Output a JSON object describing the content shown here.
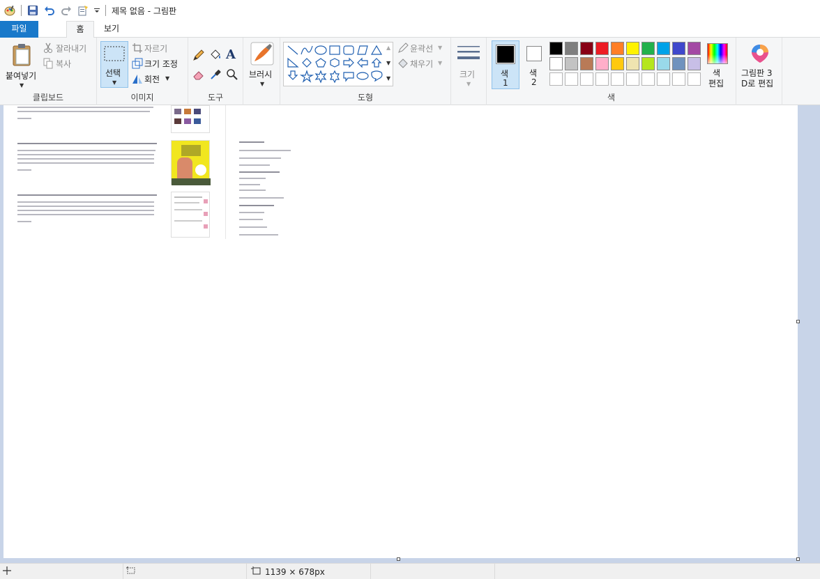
{
  "titlebar": {
    "title": "제목 없음 - 그림판",
    "icons": [
      "paint-app-icon",
      "save-icon",
      "undo-icon",
      "redo-icon",
      "properties-icon",
      "customize-dropdown-icon"
    ]
  },
  "tabs": [
    {
      "label": "파일"
    },
    {
      "label": "홈"
    },
    {
      "label": "보기"
    }
  ],
  "ribbon": {
    "clipboard": {
      "paste": "붙여넣기",
      "cut": "잘라내기",
      "copy": "복사",
      "group": "클립보드"
    },
    "image": {
      "select": "선택",
      "crop": "자르기",
      "resize": "크기 조정",
      "rotate": "회전",
      "group": "이미지"
    },
    "tools": {
      "brush": "브러시",
      "group": "도구"
    },
    "shapes": {
      "outline": "윤곽선",
      "fill": "채우기",
      "group": "도형"
    },
    "size": {
      "label": "크기"
    },
    "colors": {
      "color1": "색",
      "color1_num": "1",
      "color2": "색",
      "color2_num": "2",
      "edit": "색",
      "edit2": "편집",
      "group": "색",
      "color1_value": "#000000",
      "color2_value": "#ffffff",
      "palette_row1": [
        "#000000",
        "#7f7f7f",
        "#880015",
        "#ed1c24",
        "#ff7f27",
        "#fff200",
        "#22b14c",
        "#00a2e8",
        "#3f48cc",
        "#a349a4"
      ],
      "palette_row2": [
        "#ffffff",
        "#c3c3c3",
        "#b97a57",
        "#ffaec9",
        "#ffc90e",
        "#efe4b0",
        "#b5e61d",
        "#99d9ea",
        "#7092be",
        "#c8bfe7"
      ]
    },
    "paint3d": {
      "line1": "그림판 3",
      "line2": "D로 편집"
    }
  },
  "statusbar": {
    "canvas_size": "1139 × 678px"
  }
}
